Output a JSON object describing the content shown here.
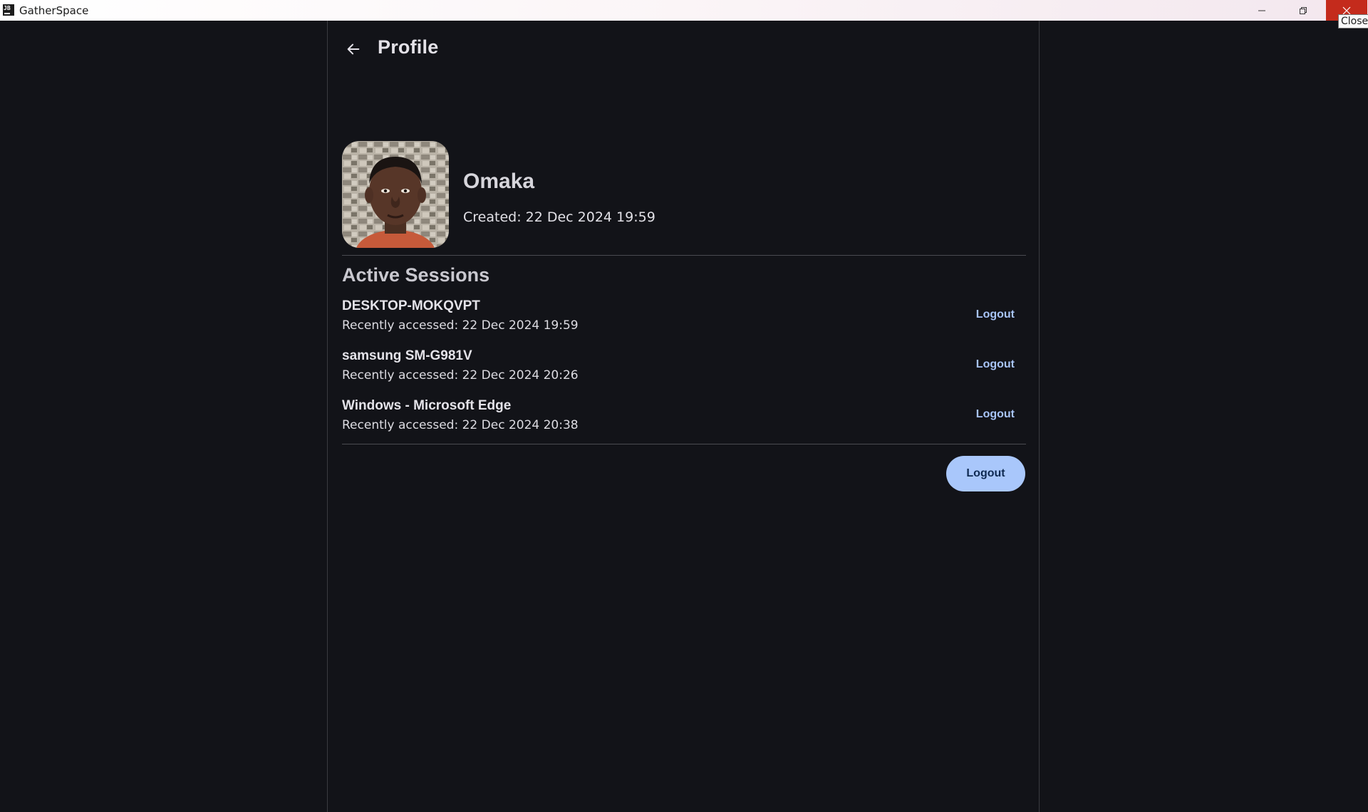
{
  "window": {
    "app_icon_text": "JB",
    "title": "GatherSpace",
    "close_tooltip": "Close"
  },
  "header": {
    "title": "Profile"
  },
  "profile": {
    "name": "Omaka",
    "created": "Created: 22 Dec 2024 19:59"
  },
  "sessions": {
    "title": "Active Sessions",
    "items": [
      {
        "device": "DESKTOP-MOKQVPT",
        "accessed": "Recently accessed: 22 Dec 2024 19:59",
        "action": "Logout"
      },
      {
        "device": "samsung SM-G981V",
        "accessed": "Recently accessed: 22 Dec 2024 20:26",
        "action": "Logout"
      },
      {
        "device": "Windows - Microsoft Edge",
        "accessed": "Recently accessed: 22 Dec 2024 20:38",
        "action": "Logout"
      }
    ]
  },
  "footer": {
    "logout_label": "Logout"
  },
  "colors": {
    "background": "#121318",
    "accent": "#a9c7fb",
    "link": "#a8c4f7",
    "close_red": "#c42b1c"
  },
  "icons": {
    "back": "arrow-left-icon",
    "minimize": "minimize-icon",
    "restore": "restore-icon",
    "close": "close-icon"
  }
}
